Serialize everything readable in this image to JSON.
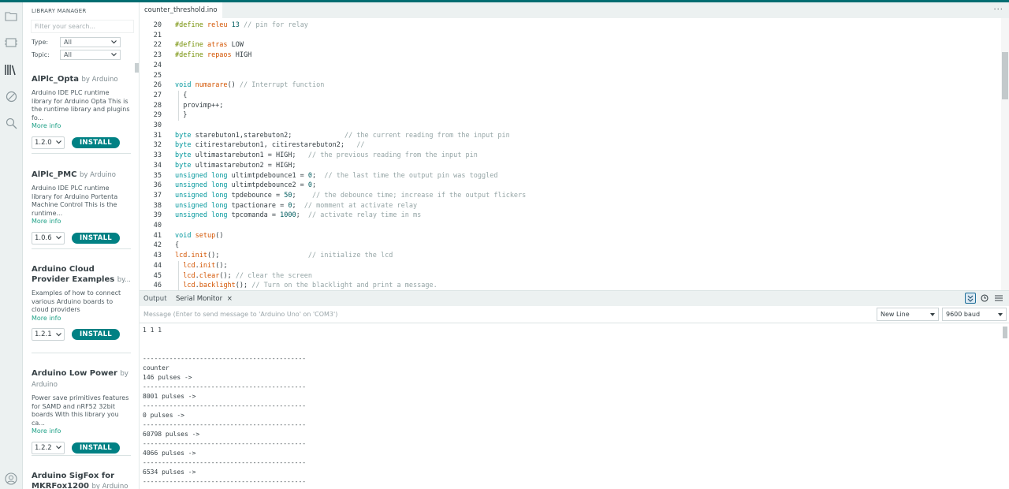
{
  "library_manager": {
    "title": "LIBRARY MANAGER",
    "search_placeholder": "Filter your search...",
    "type_label": "Type:",
    "type_value": "All",
    "topic_label": "Topic:",
    "topic_value": "All",
    "items": [
      {
        "name": "AlPlc_Opta",
        "by": "by Arduino",
        "desc": "Arduino IDE PLC runtime library for Arduino Opta This is the runtime library and plugins fo...",
        "more": "More info",
        "version": "1.2.0",
        "install": "INSTALL"
      },
      {
        "name": "AlPlc_PMC",
        "by": "by Arduino",
        "desc": "Arduino IDE PLC runtime library for Arduino Portenta Machine Control This is the runtime...",
        "more": "More info",
        "version": "1.0.6",
        "install": "INSTALL"
      },
      {
        "name": "Arduino Cloud Provider Examples",
        "by": "by...",
        "desc": "Examples of how to connect various Arduino boards to cloud providers",
        "more": "More info",
        "version": "1.2.1",
        "install": "INSTALL"
      },
      {
        "name": "Arduino Low Power",
        "by": "by Arduino",
        "desc": "Power save primitives features for SAMD and nRF52 32bit boards With this library you ca...",
        "more": "More info",
        "version": "1.2.2",
        "install": "INSTALL"
      },
      {
        "name": "Arduino SigFox for MKRFox1200",
        "by": "by Arduino",
        "desc": "",
        "more": "",
        "version": "",
        "install": ""
      }
    ]
  },
  "editor": {
    "tab": "counter_threshold.ino",
    "more": "···",
    "lines": [
      {
        "n": "20",
        "t": "#define releu 13 // pin for relay"
      },
      {
        "n": "21",
        "t": ""
      },
      {
        "n": "22",
        "t": "#define atras LOW"
      },
      {
        "n": "23",
        "t": "#define repaos HIGH"
      },
      {
        "n": "24",
        "t": ""
      },
      {
        "n": "25",
        "t": ""
      },
      {
        "n": "26",
        "t": "void numarare() // Interrupt function"
      },
      {
        "n": "27",
        "t": "  {"
      },
      {
        "n": "28",
        "t": "  provimp++;"
      },
      {
        "n": "29",
        "t": "  }"
      },
      {
        "n": "30",
        "t": ""
      },
      {
        "n": "31",
        "t": "byte starebuton1,starebuton2;             // the current reading from the input pin"
      },
      {
        "n": "32",
        "t": "byte citirestarebuton1, citirestarebuton2;   //"
      },
      {
        "n": "33",
        "t": "byte ultimastarebuton1 = HIGH;   // the previous reading from the input pin"
      },
      {
        "n": "34",
        "t": "byte ultimastarebuton2 = HIGH;"
      },
      {
        "n": "35",
        "t": "unsigned long ultimtpdebounce1 = 0;  // the last time the output pin was toggled"
      },
      {
        "n": "36",
        "t": "unsigned long ultimtpdebounce2 = 0;"
      },
      {
        "n": "37",
        "t": "unsigned long tpdebounce = 50;    // the debounce time; increase if the output flickers"
      },
      {
        "n": "38",
        "t": "unsigned long tpactionare = 0;  // momment at activate relay"
      },
      {
        "n": "39",
        "t": "unsigned long tpcomanda = 1000;  // activate relay time in ms"
      },
      {
        "n": "40",
        "t": ""
      },
      {
        "n": "41",
        "t": "void setup()"
      },
      {
        "n": "42",
        "t": "{"
      },
      {
        "n": "43",
        "t": "lcd.init();                      // initialize the lcd"
      },
      {
        "n": "44",
        "t": "  lcd.init();"
      },
      {
        "n": "45",
        "t": "  lcd.clear(); // clear the screen"
      },
      {
        "n": "46",
        "t": "  lcd.backlight(); // Turn on the blacklight and print a message."
      }
    ]
  },
  "output": {
    "tab_output": "Output",
    "tab_serial": "Serial Monitor",
    "close": "×",
    "message_placeholder": "Message (Enter to send message to 'Arduino Uno' on 'COM3')",
    "line_ending": "New Line",
    "baud": "9600 baud",
    "serial_lines": [
      "1 1 1",
      "",
      "",
      "-------------------------------------------",
      "counter",
      "146 pulses ->",
      "-------------------------------------------",
      "8001 pulses ->",
      "-------------------------------------------",
      "0 pulses ->",
      "-------------------------------------------",
      "60798 pulses ->",
      "-------------------------------------------",
      "4066 pulses ->",
      "-------------------------------------------",
      "6534 pulses ->",
      "-------------------------------------------"
    ]
  },
  "colors": {
    "accent": "#008184",
    "link": "#1da086",
    "topbar": "#006d71"
  }
}
